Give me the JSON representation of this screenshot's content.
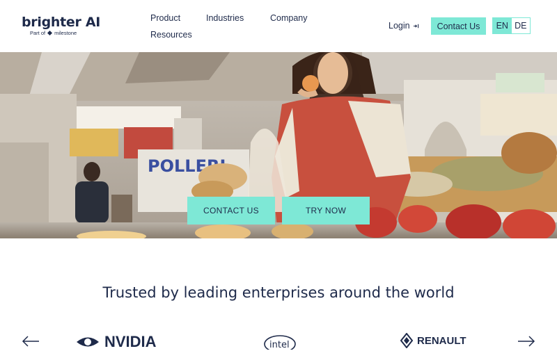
{
  "header": {
    "logo": {
      "name": "brighter AI",
      "sub_prefix": "Part of",
      "sub_brand": "milestone"
    },
    "nav": [
      "Product",
      "Industries",
      "Company",
      "Resources"
    ],
    "login_label": "Login",
    "contact_label": "Contact Us",
    "lang": {
      "en": "EN",
      "de": "DE",
      "selected": "EN"
    }
  },
  "hero": {
    "buttons": {
      "contact": "CONTACT US",
      "try": "TRY NOW"
    },
    "sign_text": "POLLERI"
  },
  "trusted": {
    "heading": "Trusted by leading enterprises around the world",
    "logos": [
      "NVIDIA",
      "intel",
      "RENAULT"
    ]
  },
  "colors": {
    "accent": "#7ee8d6",
    "text": "#1e2a4a"
  }
}
